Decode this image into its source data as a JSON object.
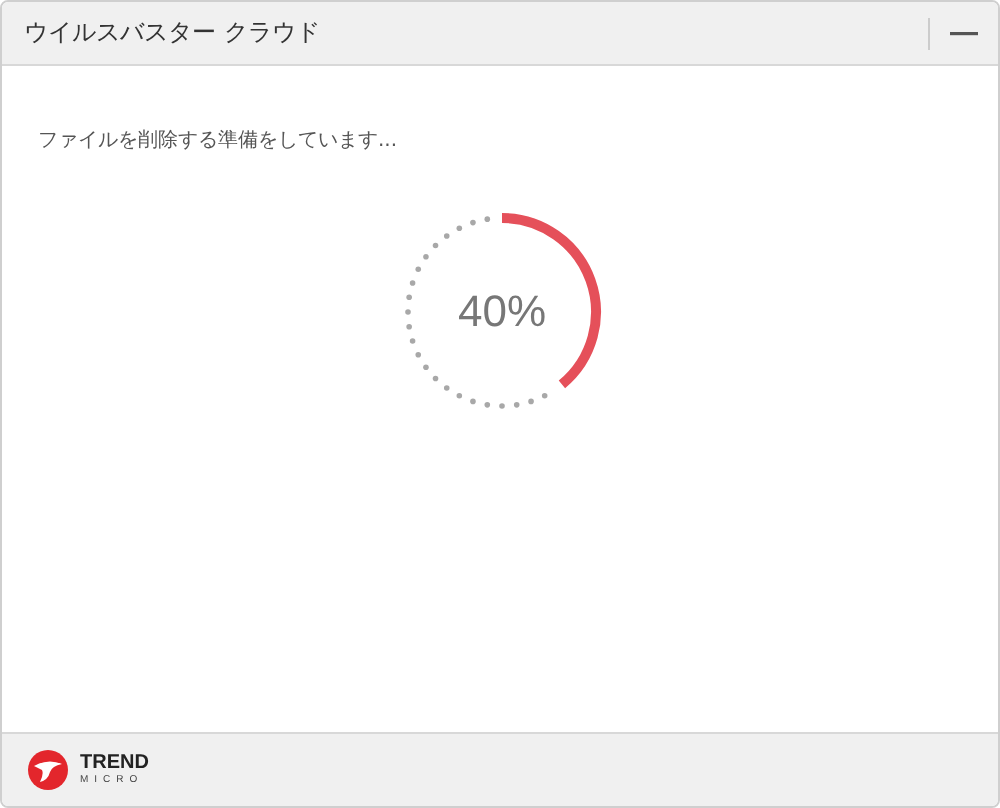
{
  "window": {
    "title": "ウイルスバスター クラウド"
  },
  "message": "ファイルを削除する準備をしています...",
  "progress": {
    "reading": "40%"
  },
  "footer": {
    "logo_top": "TREND",
    "logo_bottom": "MICRO"
  }
}
